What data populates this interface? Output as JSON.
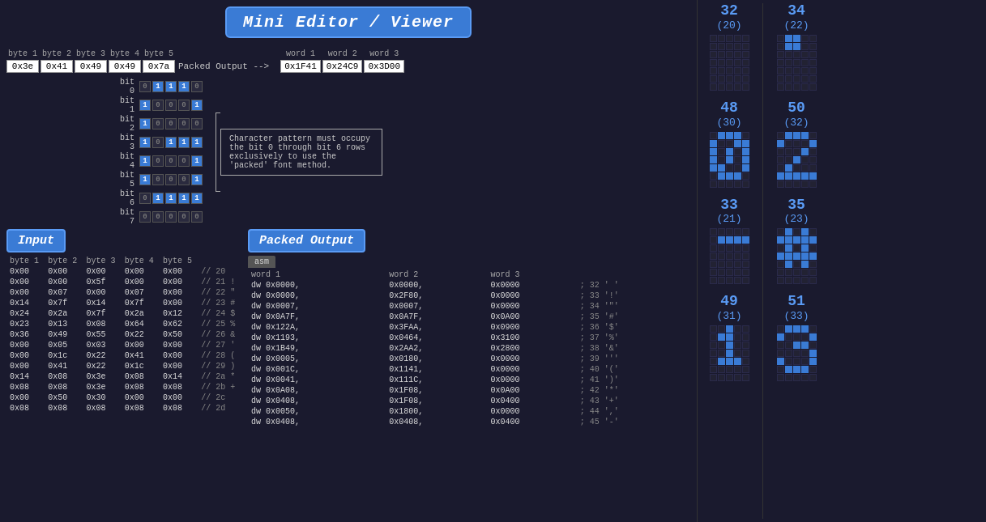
{
  "title": "Mini Editor / Viewer",
  "top": {
    "byte_labels": [
      "byte 1",
      "byte 2",
      "byte 3",
      "byte 4",
      "byte 5"
    ],
    "byte_values": [
      "0x3e",
      "0x41",
      "0x49",
      "0x49",
      "0x7a"
    ],
    "packed_label": "Packed Output -->",
    "word_labels": [
      "word 1",
      "word 2",
      "word 3"
    ],
    "word_values": [
      "0x1F41",
      "0x24C9",
      "0x3D00"
    ]
  },
  "bit_grid": {
    "rows": [
      {
        "label": "bit 0",
        "cells": [
          0,
          1,
          1,
          1,
          0
        ]
      },
      {
        "label": "bit 1",
        "cells": [
          1,
          0,
          0,
          0,
          1
        ]
      },
      {
        "label": "bit 2",
        "cells": [
          1,
          0,
          0,
          0,
          0
        ]
      },
      {
        "label": "bit 3",
        "cells": [
          1,
          0,
          1,
          1,
          1
        ]
      },
      {
        "label": "bit 4",
        "cells": [
          1,
          0,
          0,
          0,
          1
        ]
      },
      {
        "label": "bit 5",
        "cells": [
          1,
          0,
          0,
          0,
          1
        ]
      },
      {
        "label": "bit 6",
        "cells": [
          0,
          1,
          1,
          1,
          1
        ]
      },
      {
        "label": "bit 7",
        "cells": [
          0,
          0,
          0,
          0,
          0
        ]
      }
    ],
    "note": "Character pattern must occupy the bit 0 through bit 6 rows exclusively to use the 'packed' font method."
  },
  "section_input": "Input",
  "section_packed": "Packed Output",
  "input_table": {
    "headers": [
      "byte 1",
      "byte 2",
      "byte 3",
      "byte 4",
      "byte 5",
      ""
    ],
    "rows": [
      [
        "0x00",
        "0x00",
        "0x00",
        "0x00",
        "0x00",
        "// 20"
      ],
      [
        "0x00",
        "0x00",
        "0x5f",
        "0x00",
        "0x00",
        "// 21 !"
      ],
      [
        "0x00",
        "0x07",
        "0x00",
        "0x07",
        "0x00",
        "// 22 \""
      ],
      [
        "0x14",
        "0x7f",
        "0x14",
        "0x7f",
        "0x00",
        "// 23 #"
      ],
      [
        "0x24",
        "0x2a",
        "0x7f",
        "0x2a",
        "0x12",
        "// 24 $"
      ],
      [
        "0x23",
        "0x13",
        "0x08",
        "0x64",
        "0x62",
        "// 25 %"
      ],
      [
        "0x36",
        "0x49",
        "0x55",
        "0x22",
        "0x50",
        "// 26 &"
      ],
      [
        "0x00",
        "0x05",
        "0x03",
        "0x00",
        "0x00",
        "// 27 '"
      ],
      [
        "0x00",
        "0x1c",
        "0x22",
        "0x41",
        "0x00",
        "// 28 ("
      ],
      [
        "0x00",
        "0x41",
        "0x22",
        "0x1c",
        "0x00",
        "// 29 )"
      ],
      [
        "0x14",
        "0x08",
        "0x3e",
        "0x08",
        "0x14",
        "// 2a *"
      ],
      [
        "0x08",
        "0x08",
        "0x3e",
        "0x08",
        "0x08",
        "// 2b +"
      ],
      [
        "0x00",
        "0x50",
        "0x30",
        "0x00",
        "0x00",
        "// 2c"
      ],
      [
        "0x08",
        "0x08",
        "0x08",
        "0x08",
        "0x08",
        "// 2d"
      ]
    ]
  },
  "packed_table": {
    "tab": "asm",
    "headers": [
      "word 1",
      "word 2",
      "word 3",
      ""
    ],
    "rows": [
      [
        "dw 0x0000,",
        "0x0000,",
        "0x0000",
        "; 32 ' '"
      ],
      [
        "dw 0x0000,",
        "0x2F80,",
        "0x0000",
        "; 33 '!'"
      ],
      [
        "dw 0x0007,",
        "0x0007,",
        "0x0000",
        "; 34 '\"'"
      ],
      [
        "dw 0x0A7F,",
        "0x0A7F,",
        "0x0A00",
        "; 35 '#'"
      ],
      [
        "dw 0x122A,",
        "0x3FAA,",
        "0x0900",
        "; 36 '$'"
      ],
      [
        "dw 0x1193,",
        "0x0464,",
        "0x3100",
        "; 37 '%'"
      ],
      [
        "dw 0x1B49,",
        "0x2AA2,",
        "0x2800",
        "; 38 '&'"
      ],
      [
        "dw 0x0005,",
        "0x0180,",
        "0x0000",
        "; 39 '''"
      ],
      [
        "dw 0x001C,",
        "0x1141,",
        "0x0000",
        "; 40 '('"
      ],
      [
        "dw 0x0041,",
        "0x111C,",
        "0x0000",
        "; 41 ')'"
      ],
      [
        "dw 0x0A08,",
        "0x1F08,",
        "0x0A00",
        "; 42 '*'"
      ],
      [
        "dw 0x0408,",
        "0x1F08,",
        "0x0400",
        "; 43 '+'"
      ],
      [
        "dw 0x0050,",
        "0x1800,",
        "0x0000",
        "; 44 ','"
      ],
      [
        "dw 0x0408,",
        "0x0408,",
        "0x0400",
        "; 45 '-'"
      ]
    ]
  },
  "right_chars": [
    {
      "number": "32",
      "sub": "(20)",
      "grid": [
        [
          0,
          0,
          0,
          0,
          0
        ],
        [
          0,
          0,
          0,
          0,
          0
        ],
        [
          0,
          0,
          0,
          0,
          0
        ],
        [
          0,
          0,
          0,
          0,
          0
        ],
        [
          0,
          0,
          0,
          0,
          0
        ],
        [
          0,
          0,
          0,
          0,
          0
        ],
        [
          0,
          0,
          0,
          0,
          0
        ]
      ]
    },
    {
      "number": "48",
      "sub": "(30)",
      "grid": [
        [
          0,
          1,
          1,
          1,
          0
        ],
        [
          1,
          0,
          0,
          1,
          1
        ],
        [
          1,
          0,
          1,
          0,
          1
        ],
        [
          1,
          0,
          1,
          0,
          1
        ],
        [
          1,
          1,
          0,
          0,
          1
        ],
        [
          0,
          1,
          1,
          1,
          0
        ],
        [
          0,
          0,
          0,
          0,
          0
        ]
      ]
    },
    {
      "number": "33",
      "sub": "(21)",
      "grid": [
        [
          0,
          0,
          0,
          0,
          0
        ],
        [
          0,
          1,
          1,
          1,
          1
        ],
        [
          0,
          0,
          0,
          0,
          0
        ],
        [
          0,
          0,
          0,
          0,
          0
        ],
        [
          0,
          0,
          0,
          0,
          0
        ],
        [
          0,
          0,
          0,
          0,
          0
        ],
        [
          0,
          0,
          0,
          0,
          0
        ]
      ]
    },
    {
      "number": "49",
      "sub": "(31)",
      "grid": [
        [
          0,
          0,
          1,
          0,
          0
        ],
        [
          0,
          1,
          1,
          0,
          0
        ],
        [
          0,
          0,
          1,
          0,
          0
        ],
        [
          0,
          0,
          1,
          0,
          0
        ],
        [
          0,
          1,
          1,
          1,
          0
        ],
        [
          0,
          0,
          0,
          0,
          0
        ],
        [
          0,
          0,
          0,
          0,
          0
        ]
      ]
    },
    {
      "number": "34",
      "sub": "(22)",
      "grid": [
        [
          0,
          1,
          1,
          0,
          0
        ],
        [
          0,
          1,
          1,
          0,
          0
        ],
        [
          0,
          0,
          0,
          0,
          0
        ],
        [
          0,
          0,
          0,
          0,
          0
        ],
        [
          0,
          0,
          0,
          0,
          0
        ],
        [
          0,
          0,
          0,
          0,
          0
        ],
        [
          0,
          0,
          0,
          0,
          0
        ]
      ]
    },
    {
      "number": "50",
      "sub": "(32)",
      "grid": [
        [
          0,
          1,
          1,
          1,
          0
        ],
        [
          1,
          0,
          0,
          0,
          1
        ],
        [
          0,
          0,
          0,
          1,
          0
        ],
        [
          0,
          0,
          1,
          0,
          0
        ],
        [
          0,
          1,
          0,
          0,
          0
        ],
        [
          1,
          1,
          1,
          1,
          1
        ],
        [
          0,
          0,
          0,
          0,
          0
        ]
      ]
    },
    {
      "number": "35",
      "sub": "(23)",
      "grid": [
        [
          0,
          1,
          0,
          1,
          0
        ],
        [
          1,
          1,
          1,
          1,
          1
        ],
        [
          0,
          1,
          0,
          1,
          0
        ],
        [
          1,
          1,
          1,
          1,
          1
        ],
        [
          0,
          1,
          0,
          1,
          0
        ],
        [
          0,
          0,
          0,
          0,
          0
        ],
        [
          0,
          0,
          0,
          0,
          0
        ]
      ]
    },
    {
      "number": "51",
      "sub": "(33)",
      "grid": [
        [
          0,
          1,
          1,
          1,
          0
        ],
        [
          1,
          0,
          0,
          0,
          1
        ],
        [
          0,
          0,
          1,
          1,
          0
        ],
        [
          0,
          0,
          0,
          0,
          1
        ],
        [
          1,
          0,
          0,
          0,
          1
        ],
        [
          0,
          1,
          1,
          1,
          0
        ],
        [
          0,
          0,
          0,
          0,
          0
        ]
      ]
    }
  ]
}
